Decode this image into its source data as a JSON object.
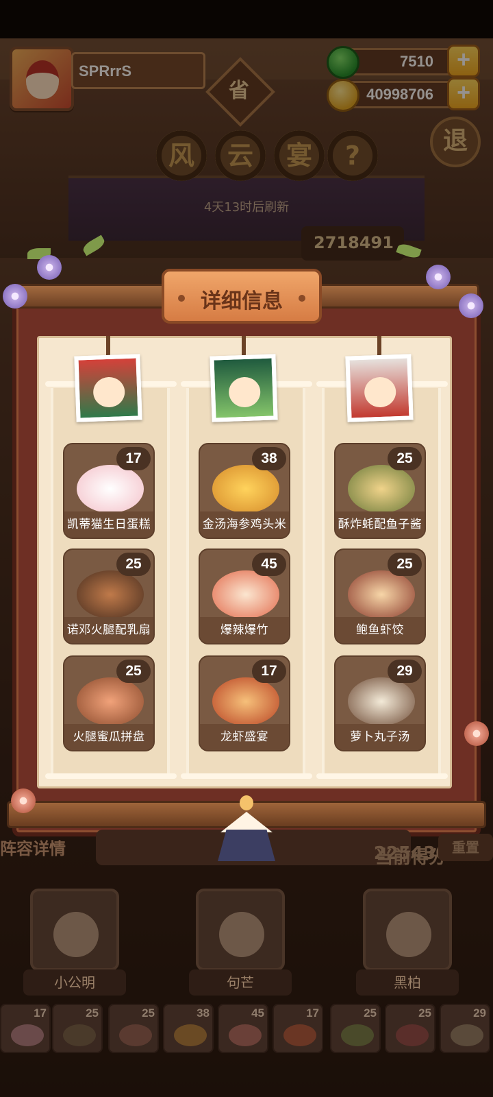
{
  "player": {
    "name": "SPRrrS"
  },
  "resources": {
    "jade": "7510",
    "coins": "40998706"
  },
  "header": {
    "province_badge": "省",
    "title_chars": [
      "风",
      "云",
      "宴"
    ],
    "help": "?",
    "refresh_text": "4天13时后刷新",
    "exit_label": "退",
    "score_partial": "2718491"
  },
  "panel": {
    "title": "详细信息",
    "columns": [
      {
        "hero": "小公明",
        "dishes": [
          {
            "name": "凯蒂猫生日蛋糕",
            "count": "17",
            "color": "#f4c0c8"
          },
          {
            "name": "诺邓火腿配乳扇",
            "count": "25",
            "color": "#c07a4a"
          },
          {
            "name": "火腿蜜瓜拼盘",
            "count": "25",
            "color": "#d8825e"
          }
        ]
      },
      {
        "hero": "句芒",
        "dishes": [
          {
            "name": "金汤海参鸡头米",
            "count": "38",
            "color": "#f0b84e"
          },
          {
            "name": "爆辣爆竹",
            "count": "45",
            "color": "#e26a4c"
          },
          {
            "name": "龙虾盛宴",
            "count": "17",
            "color": "#d9622e"
          }
        ]
      },
      {
        "hero": "黑柏",
        "dishes": [
          {
            "name": "酥炸蚝配鱼子酱",
            "count": "25",
            "color": "#8da056"
          },
          {
            "name": "鲍鱼虾饺",
            "count": "25",
            "color": "#b55a44"
          },
          {
            "name": "萝卜丸子汤",
            "count": "29",
            "color": "#e8d6b0"
          }
        ]
      }
    ]
  },
  "bottom": {
    "lineup_label": "阵容详情",
    "current_score_label": "当前得分",
    "current_score": "225430",
    "reset_label": "重置",
    "team": [
      "小公明",
      "句芒",
      "黑柏"
    ],
    "tiles": [
      "17",
      "25",
      "25",
      "38",
      "45",
      "17",
      "25",
      "25",
      "29"
    ]
  }
}
